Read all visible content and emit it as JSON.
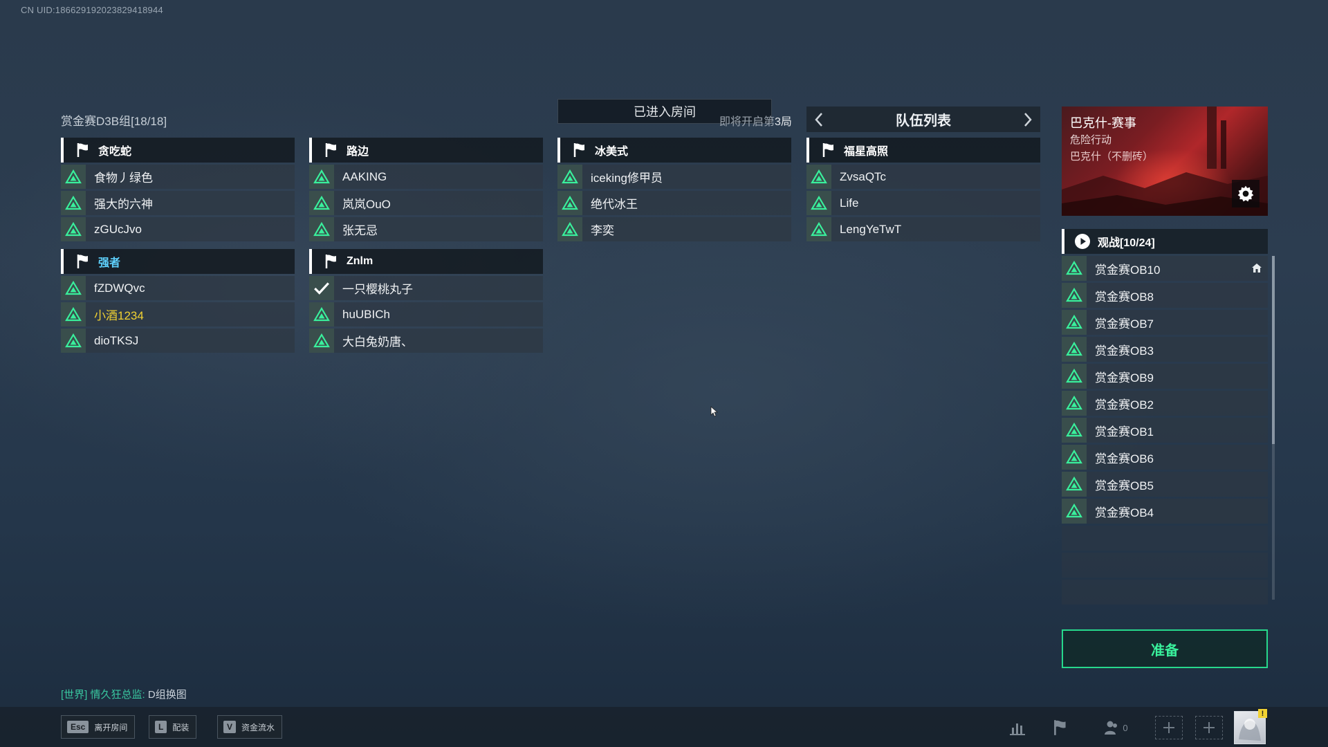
{
  "header": {
    "uid": "CN UID:186629192023829418944",
    "room_title": "赏金赛D3B组[18/18]",
    "entered_room": "已进入房间",
    "round_hint_prefix": "即将开启第",
    "round_hint_num": "3局"
  },
  "teams": [
    {
      "name": "贪吃蛇",
      "players": [
        "食物丿绿色",
        "强大的六神",
        "zGUcJvo"
      ]
    },
    {
      "name": "路边",
      "players": [
        "AAKING",
        "岚岚OuO",
        "张无忌"
      ]
    },
    {
      "name": "冰美式",
      "players": [
        "iceking修甲员",
        "绝代冰王",
        "李奕"
      ]
    },
    {
      "name": "福星高照",
      "players": [
        "ZvsaQTc",
        "Life",
        "LengYeTwT"
      ]
    },
    {
      "name": "强者",
      "players": [
        "fZDWQvc",
        "小酒1234",
        "dioTKSJ"
      ]
    },
    {
      "name": "Znlm",
      "players": [
        "一只樱桃丸子",
        "huUBICh",
        "大白兔奶唐、"
      ]
    }
  ],
  "team_list": {
    "title": "队伍列表"
  },
  "map": {
    "name": "巴克什-赛事",
    "mode": "危险行动",
    "desc": "巴克什（不删砖）"
  },
  "spectators": {
    "title": "观战[10/24]",
    "items": [
      "赏金赛OB10",
      "赏金赛OB8",
      "赏金赛OB7",
      "赏金赛OB3",
      "赏金赛OB9",
      "赏金赛OB2",
      "赏金赛OB1",
      "赏金赛OB6",
      "赏金赛OB5",
      "赏金赛OB4"
    ]
  },
  "ready_button": "准备",
  "chat": {
    "channel": "[世界]",
    "sender": "情久狂总监:",
    "message": "D组换图"
  },
  "bottom": {
    "leave": {
      "key": "Esc",
      "label": "离开房间"
    },
    "loadout": {
      "key": "L",
      "label": "配装"
    },
    "funds": {
      "key": "V",
      "label": "资金流水"
    },
    "friends_count": "0",
    "avatar_badge": "!"
  },
  "colors": {
    "accent_green": "#39f09c",
    "team_blue": "#5fd2ff",
    "highlight_yellow": "#f2d232"
  }
}
